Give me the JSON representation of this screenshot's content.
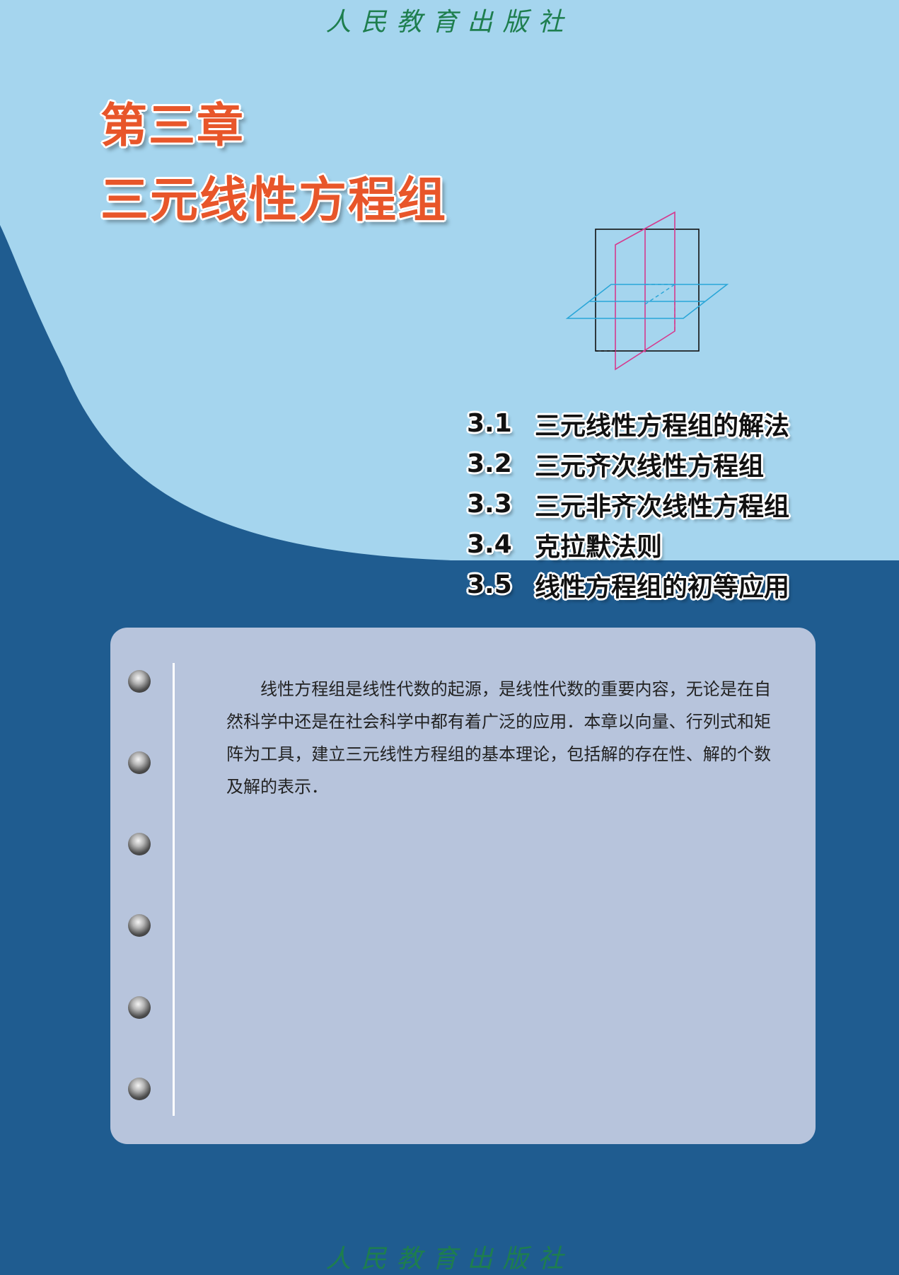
{
  "publisher": "人民教育出版社",
  "chapter": {
    "number_label": "第三章",
    "title": "三元线性方程组"
  },
  "toc": [
    {
      "num": "3.1",
      "title": "三元线性方程组的解法"
    },
    {
      "num": "3.2",
      "title": "三元齐次线性方程组"
    },
    {
      "num": "3.3",
      "title": "三元非齐次线性方程组"
    },
    {
      "num": "3.4",
      "title": "克拉默法则"
    },
    {
      "num": "3.5",
      "title": "线性方程组的初等应用"
    }
  ],
  "intro": "线性方程组是线性代数的起源，是线性代数的重要内容，无论是在自然科学中还是在社会科学中都有着广泛的应用．本章以向量、行列式和矩阵为工具，建立三元线性方程组的基本理论，包括解的存在性、解的个数及解的表示．",
  "colors": {
    "light_blue": "#a5d5ee",
    "dark_blue": "#1f5c90",
    "title_orange": "#e8562a",
    "card": "#b7c4dc",
    "publisher_green": "#1e7e4e",
    "plane_magenta": "#d63a8e",
    "plane_cyan": "#2aa6d8"
  }
}
